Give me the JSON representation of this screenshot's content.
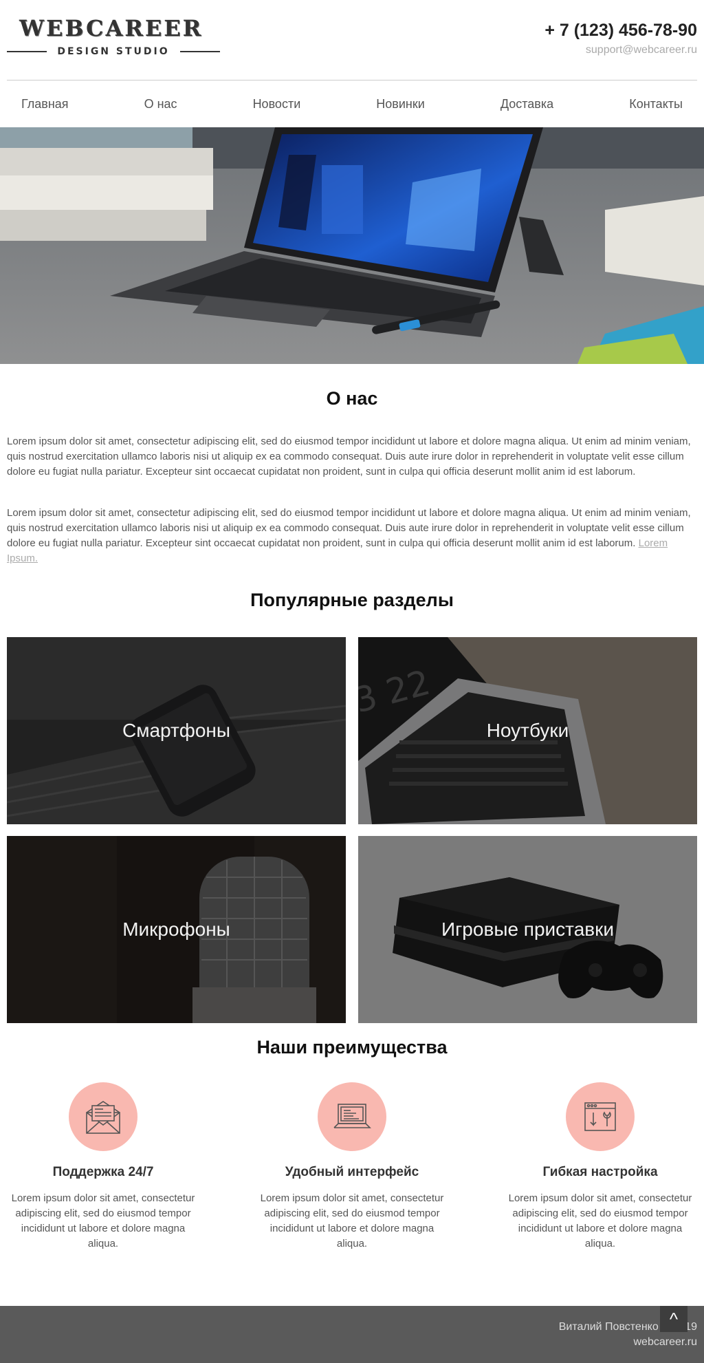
{
  "header": {
    "logo_main": "WEBCAREER",
    "logo_sub": "DESIGN STUDIO",
    "phone": "+ 7 (123) 456-78-90",
    "email": "support@webcareer.ru"
  },
  "nav": {
    "items": [
      {
        "label": "Главная"
      },
      {
        "label": "О нас"
      },
      {
        "label": "Новости"
      },
      {
        "label": "Новинки"
      },
      {
        "label": "Доставка"
      },
      {
        "label": "Контакты"
      }
    ]
  },
  "slider": {
    "slides_count": 3,
    "active_slide": 1
  },
  "about": {
    "title": "О нас",
    "paragraph1": "Lorem ipsum dolor sit amet, consectetur adipiscing elit, sed do eiusmod tempor incididunt ut labore et dolore magna aliqua. Ut enim ad minim veniam, quis nostrud exercitation ullamco laboris nisi ut aliquip ex ea commodo consequat. Duis aute irure dolor in reprehenderit in voluptate velit esse cillum dolore eu fugiat nulla pariatur. Excepteur sint occaecat cupidatat non proident, sunt in culpa qui officia deserunt mollit anim id est laborum.",
    "paragraph2": "Lorem ipsum dolor sit amet, consectetur adipiscing elit, sed do eiusmod tempor incididunt ut labore et dolore magna aliqua. Ut enim ad minim veniam, quis nostrud exercitation ullamco laboris nisi ut aliquip ex ea commodo consequat. Duis aute irure dolor in reprehenderit in voluptate velit esse cillum dolore eu fugiat nulla pariatur. Excepteur sint occaecat cupidatat non proident, sunt in culpa qui officia deserunt mollit anim id est laborum.",
    "link_text": "Lorem Ipsum."
  },
  "popular": {
    "title": "Популярные разделы",
    "categories": [
      {
        "label": "Смартфоны"
      },
      {
        "label": "Ноутбуки"
      },
      {
        "label": "Микрофоны"
      },
      {
        "label": "Игровые приставки"
      }
    ]
  },
  "advantages": {
    "title": "Наши преимущества",
    "items": [
      {
        "title": "Поддержка 24/7",
        "text": "Lorem ipsum dolor sit amet, consectetur adipiscing elit, sed do eiusmod tempor incididunt ut labore et dolore magna aliqua.",
        "icon": "envelope-icon"
      },
      {
        "title": "Удобный интерфейс",
        "text": "Lorem ipsum dolor sit amet, consectetur adipiscing elit, sed do eiusmod tempor incididunt ut labore et dolore magna aliqua.",
        "icon": "laptop-icon"
      },
      {
        "title": "Гибкая настройка",
        "text": "Lorem ipsum dolor sit amet, consectetur adipiscing elit, sed do eiusmod tempor incididunt ut labore et dolore magna aliqua.",
        "icon": "settings-window-icon"
      }
    ],
    "circle_color": "#f9b8b0"
  },
  "footer": {
    "author": "Виталий Повстенко © 2019",
    "site": "webcareer.ru",
    "to_top_label": "^"
  }
}
